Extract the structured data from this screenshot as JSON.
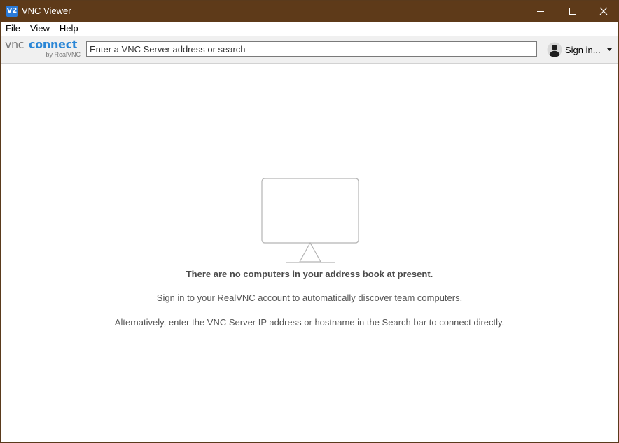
{
  "window": {
    "title": "VNC Viewer",
    "app_icon_text": "V2",
    "titlebar_color": "#5e3a19"
  },
  "menu": {
    "items": [
      "File",
      "View",
      "Help"
    ]
  },
  "toolbar": {
    "logo": {
      "part1": "vnc",
      "part2": "connect",
      "byline": "by RealVNC"
    },
    "search": {
      "placeholder": "Enter a VNC Server address or search",
      "value": ""
    },
    "signin_label": "Sign in..."
  },
  "main": {
    "empty_title": "There are no computers in your address book at present.",
    "empty_line1": "Sign in to your RealVNC account to automatically discover team computers.",
    "empty_line2": "Alternatively, enter the VNC Server IP address or hostname in the Search bar to connect directly."
  },
  "colors": {
    "accent": "#2a86d6",
    "logo_gray": "#7a7a7a"
  },
  "icons": {
    "app": "vnc-viewer-icon",
    "minimize": "minimize-icon",
    "maximize": "maximize-icon",
    "close": "close-icon",
    "user": "user-avatar-icon",
    "dropdown": "chevron-down-icon",
    "empty_state": "monitor-icon"
  }
}
